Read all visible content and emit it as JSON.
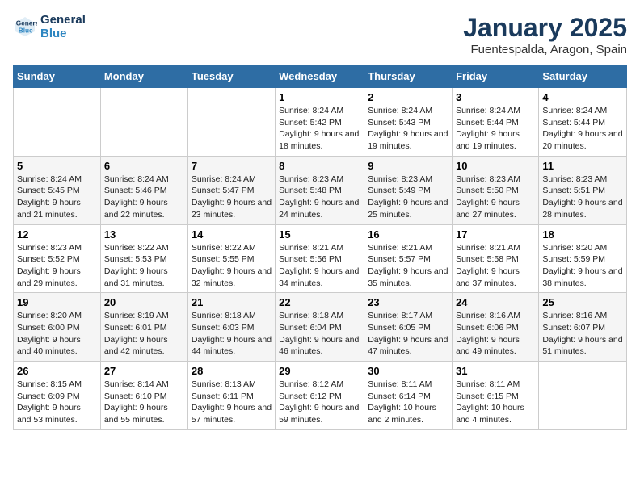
{
  "logo": {
    "line1": "General",
    "line2": "Blue"
  },
  "title": "January 2025",
  "subtitle": "Fuentespalda, Aragon, Spain",
  "weekdays": [
    "Sunday",
    "Monday",
    "Tuesday",
    "Wednesday",
    "Thursday",
    "Friday",
    "Saturday"
  ],
  "weeks": [
    [
      {
        "day": "",
        "sunrise": "",
        "sunset": "",
        "daylight": ""
      },
      {
        "day": "",
        "sunrise": "",
        "sunset": "",
        "daylight": ""
      },
      {
        "day": "",
        "sunrise": "",
        "sunset": "",
        "daylight": ""
      },
      {
        "day": "1",
        "sunrise": "Sunrise: 8:24 AM",
        "sunset": "Sunset: 5:42 PM",
        "daylight": "Daylight: 9 hours and 18 minutes."
      },
      {
        "day": "2",
        "sunrise": "Sunrise: 8:24 AM",
        "sunset": "Sunset: 5:43 PM",
        "daylight": "Daylight: 9 hours and 19 minutes."
      },
      {
        "day": "3",
        "sunrise": "Sunrise: 8:24 AM",
        "sunset": "Sunset: 5:44 PM",
        "daylight": "Daylight: 9 hours and 19 minutes."
      },
      {
        "day": "4",
        "sunrise": "Sunrise: 8:24 AM",
        "sunset": "Sunset: 5:44 PM",
        "daylight": "Daylight: 9 hours and 20 minutes."
      }
    ],
    [
      {
        "day": "5",
        "sunrise": "Sunrise: 8:24 AM",
        "sunset": "Sunset: 5:45 PM",
        "daylight": "Daylight: 9 hours and 21 minutes."
      },
      {
        "day": "6",
        "sunrise": "Sunrise: 8:24 AM",
        "sunset": "Sunset: 5:46 PM",
        "daylight": "Daylight: 9 hours and 22 minutes."
      },
      {
        "day": "7",
        "sunrise": "Sunrise: 8:24 AM",
        "sunset": "Sunset: 5:47 PM",
        "daylight": "Daylight: 9 hours and 23 minutes."
      },
      {
        "day": "8",
        "sunrise": "Sunrise: 8:23 AM",
        "sunset": "Sunset: 5:48 PM",
        "daylight": "Daylight: 9 hours and 24 minutes."
      },
      {
        "day": "9",
        "sunrise": "Sunrise: 8:23 AM",
        "sunset": "Sunset: 5:49 PM",
        "daylight": "Daylight: 9 hours and 25 minutes."
      },
      {
        "day": "10",
        "sunrise": "Sunrise: 8:23 AM",
        "sunset": "Sunset: 5:50 PM",
        "daylight": "Daylight: 9 hours and 27 minutes."
      },
      {
        "day": "11",
        "sunrise": "Sunrise: 8:23 AM",
        "sunset": "Sunset: 5:51 PM",
        "daylight": "Daylight: 9 hours and 28 minutes."
      }
    ],
    [
      {
        "day": "12",
        "sunrise": "Sunrise: 8:23 AM",
        "sunset": "Sunset: 5:52 PM",
        "daylight": "Daylight: 9 hours and 29 minutes."
      },
      {
        "day": "13",
        "sunrise": "Sunrise: 8:22 AM",
        "sunset": "Sunset: 5:53 PM",
        "daylight": "Daylight: 9 hours and 31 minutes."
      },
      {
        "day": "14",
        "sunrise": "Sunrise: 8:22 AM",
        "sunset": "Sunset: 5:55 PM",
        "daylight": "Daylight: 9 hours and 32 minutes."
      },
      {
        "day": "15",
        "sunrise": "Sunrise: 8:21 AM",
        "sunset": "Sunset: 5:56 PM",
        "daylight": "Daylight: 9 hours and 34 minutes."
      },
      {
        "day": "16",
        "sunrise": "Sunrise: 8:21 AM",
        "sunset": "Sunset: 5:57 PM",
        "daylight": "Daylight: 9 hours and 35 minutes."
      },
      {
        "day": "17",
        "sunrise": "Sunrise: 8:21 AM",
        "sunset": "Sunset: 5:58 PM",
        "daylight": "Daylight: 9 hours and 37 minutes."
      },
      {
        "day": "18",
        "sunrise": "Sunrise: 8:20 AM",
        "sunset": "Sunset: 5:59 PM",
        "daylight": "Daylight: 9 hours and 38 minutes."
      }
    ],
    [
      {
        "day": "19",
        "sunrise": "Sunrise: 8:20 AM",
        "sunset": "Sunset: 6:00 PM",
        "daylight": "Daylight: 9 hours and 40 minutes."
      },
      {
        "day": "20",
        "sunrise": "Sunrise: 8:19 AM",
        "sunset": "Sunset: 6:01 PM",
        "daylight": "Daylight: 9 hours and 42 minutes."
      },
      {
        "day": "21",
        "sunrise": "Sunrise: 8:18 AM",
        "sunset": "Sunset: 6:03 PM",
        "daylight": "Daylight: 9 hours and 44 minutes."
      },
      {
        "day": "22",
        "sunrise": "Sunrise: 8:18 AM",
        "sunset": "Sunset: 6:04 PM",
        "daylight": "Daylight: 9 hours and 46 minutes."
      },
      {
        "day": "23",
        "sunrise": "Sunrise: 8:17 AM",
        "sunset": "Sunset: 6:05 PM",
        "daylight": "Daylight: 9 hours and 47 minutes."
      },
      {
        "day": "24",
        "sunrise": "Sunrise: 8:16 AM",
        "sunset": "Sunset: 6:06 PM",
        "daylight": "Daylight: 9 hours and 49 minutes."
      },
      {
        "day": "25",
        "sunrise": "Sunrise: 8:16 AM",
        "sunset": "Sunset: 6:07 PM",
        "daylight": "Daylight: 9 hours and 51 minutes."
      }
    ],
    [
      {
        "day": "26",
        "sunrise": "Sunrise: 8:15 AM",
        "sunset": "Sunset: 6:09 PM",
        "daylight": "Daylight: 9 hours and 53 minutes."
      },
      {
        "day": "27",
        "sunrise": "Sunrise: 8:14 AM",
        "sunset": "Sunset: 6:10 PM",
        "daylight": "Daylight: 9 hours and 55 minutes."
      },
      {
        "day": "28",
        "sunrise": "Sunrise: 8:13 AM",
        "sunset": "Sunset: 6:11 PM",
        "daylight": "Daylight: 9 hours and 57 minutes."
      },
      {
        "day": "29",
        "sunrise": "Sunrise: 8:12 AM",
        "sunset": "Sunset: 6:12 PM",
        "daylight": "Daylight: 9 hours and 59 minutes."
      },
      {
        "day": "30",
        "sunrise": "Sunrise: 8:11 AM",
        "sunset": "Sunset: 6:14 PM",
        "daylight": "Daylight: 10 hours and 2 minutes."
      },
      {
        "day": "31",
        "sunrise": "Sunrise: 8:11 AM",
        "sunset": "Sunset: 6:15 PM",
        "daylight": "Daylight: 10 hours and 4 minutes."
      },
      {
        "day": "",
        "sunrise": "",
        "sunset": "",
        "daylight": ""
      }
    ]
  ]
}
